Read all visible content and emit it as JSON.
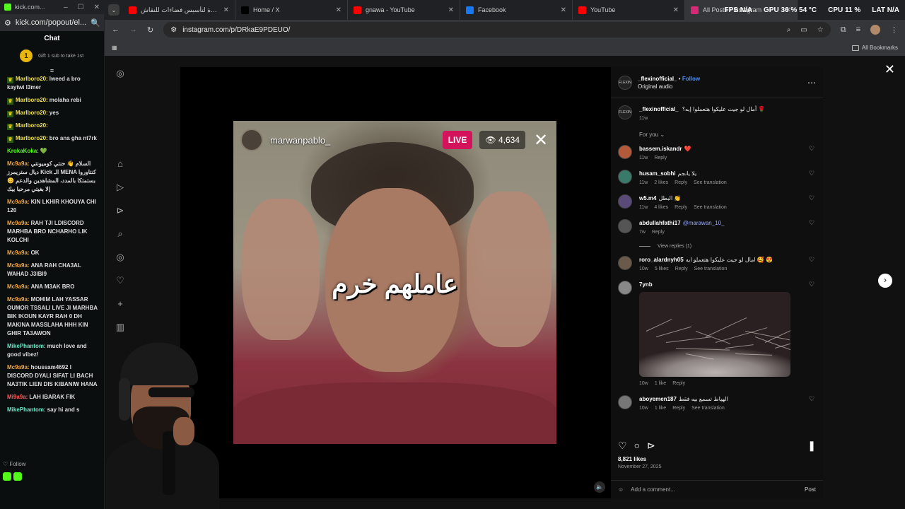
{
  "chat_window": {
    "title": "kick.com...",
    "url": "kick.com/popout/el...",
    "header": "Chat",
    "gift_count": "1",
    "gift_text": "Gift 1 sub to take 1st",
    "messages": [
      {
        "user": "Marlboro20:",
        "text": "lweed a bro kaytwi l3mer",
        "color": "#f2e34b",
        "badge": true
      },
      {
        "user": "Marlboro20:",
        "text": "molaha rebi",
        "color": "#f2e34b",
        "badge": true
      },
      {
        "user": "Marlboro20:",
        "text": "yes",
        "color": "#f2e34b",
        "badge": true
      },
      {
        "user": "Marlboro20:",
        "text": "",
        "color": "#f2e34b",
        "badge": true
      },
      {
        "user": "Marlboro20:",
        "text": "bro ana gha nt7rk",
        "color": "#f2e34b",
        "badge": true
      },
      {
        "user": "KrokaKoka:",
        "text": "💚",
        "color": "#53fc18",
        "badge": false
      },
      {
        "user": "Mc9a9a:",
        "text": "السلام 👋 حنتي كوميونتي ديال ستريمرز Kick الـ MENA كنتاوروا بستمتكا بالمدد، المشاهدين والدعم 😊 إلا بغيتي مرحبا بيك",
        "color": "#f4a742",
        "badge": false
      },
      {
        "user": "Mc9a9a:",
        "text": "KIN LKHIR KHOUYA CHI 120",
        "color": "#f4a742",
        "badge": false
      },
      {
        "user": "Mc9a9a:",
        "text": "RAH TJI LDISCORD MARHBA BRO NCHARHO LIK KOLCHI",
        "color": "#f4a742",
        "badge": false
      },
      {
        "user": "Mc9a9a:",
        "text": "OK",
        "color": "#f4a742",
        "badge": false
      },
      {
        "user": "Mc9a9a:",
        "text": "ANA RAH CHA3AL WAHAD J3IBI9",
        "color": "#f4a742",
        "badge": false
      },
      {
        "user": "Mc9a9a:",
        "text": "ANA M3AK BRO",
        "color": "#f4a742",
        "badge": false
      },
      {
        "user": "Mc9a9a:",
        "text": "MOHIM LAH YASSAR OUMOR TSSALI LIVE JI MARHBA BIK IKOUN KAYR RAH 0 DH MAKINA MASSLAHA HHH KIN GHIR TA3AWON",
        "color": "#f4a742",
        "badge": false
      },
      {
        "user": "MikePhantom:",
        "text": "much love and good vibez!",
        "color": "#6ee7c8",
        "badge": false
      },
      {
        "user": "Mc9a9a:",
        "text": "houssam4692 I DISCORD DYALI SIFAT LI BACH NA3TIK LIEN DIS KIBANIW HANA",
        "color": "#f4a742",
        "badge": false
      },
      {
        "user": "Mi9a9a:",
        "text": "LAH IBARAK FIK",
        "color": "#ff5b5b",
        "badge": false
      },
      {
        "user": "MikePhantom:",
        "text": "say hi and s",
        "color": "#6ee7c8",
        "badge": false
      }
    ],
    "follow_label": "Follow"
  },
  "tabs": [
    {
      "title": "دعوة لتأسيس فضاءات للنقاش",
      "icon": "youtube-icon",
      "color": "#ff0000",
      "active": false
    },
    {
      "title": "Home / X",
      "icon": "x-icon",
      "color": "#000000",
      "active": false
    },
    {
      "title": "gnawa - YouTube",
      "icon": "youtube-icon",
      "color": "#ff0000",
      "active": false
    },
    {
      "title": "Facebook",
      "icon": "facebook-icon",
      "color": "#1877f2",
      "active": false
    },
    {
      "title": "YouTube",
      "icon": "youtube-icon",
      "color": "#ff0000",
      "active": false
    },
    {
      "title": "All Posts • Instagram",
      "icon": "instagram-icon",
      "color": "#d62976",
      "active": true
    }
  ],
  "overlay": {
    "fps": "FPS N/A",
    "gpu": "GPU 36 % 54 °C",
    "cpu": "CPU 11 %",
    "lat": "LAT N/A"
  },
  "address_bar": {
    "url": "instagram.com/p/DRkaE9PDEUO/"
  },
  "bookmarks": {
    "all_label": "All Bookmarks"
  },
  "video": {
    "username": "marwanpablo_",
    "live_label": "LIVE",
    "viewers": "4,634",
    "caption": "عاملهم خرم"
  },
  "post": {
    "author": "_flexinofficial_",
    "follow_label": "Follow",
    "audio": "Original audio",
    "author_caption": "أمال لو جيت عليكوا هتعملوا إيه؟ 🌹",
    "author_time": "11w",
    "for_you": "For you",
    "comments": [
      {
        "user": "bassem.iskandr",
        "text": "❤️",
        "time": "11w",
        "likes": "",
        "translate": false,
        "avatar": "#b35a3a"
      },
      {
        "user": "husam_sobhi",
        "text": "يلا يانجم",
        "time": "11w",
        "likes": "2 likes",
        "translate": true,
        "avatar": "#3a7a6a"
      },
      {
        "user": "w5.m4",
        "text": "البطل 👏",
        "time": "11w",
        "likes": "4 likes",
        "translate": true,
        "avatar": "#5a4a7a"
      },
      {
        "user": "abdullahfathi17",
        "text": "@marawan_10_",
        "time": "7w",
        "likes": "",
        "translate": false,
        "avatar": "#555555",
        "mention": true
      }
    ],
    "view_replies": "View replies (1)",
    "comments2": [
      {
        "user": "roro_alardnyh05",
        "text": "امال لو جيت عليكوا هتعملو ايه 🥰 😍",
        "time": "10w",
        "likes": "5 likes",
        "translate": true,
        "avatar": "#6a5a4a"
      },
      {
        "user": "7ynb",
        "text": "",
        "time": "10w",
        "likes": "1 like",
        "translate": false,
        "avatar": "#888888",
        "image": true
      },
      {
        "user": "aboyemen187",
        "text": "الهياط تسمع بيه فقط",
        "time": "10w",
        "likes": "1 like",
        "translate": true,
        "avatar": "#777777"
      }
    ],
    "reply_label": "Reply",
    "translate_label": "See translation",
    "likes_count": "8,821 likes",
    "date": "November 27, 2025",
    "add_comment": "Add a comment...",
    "post_label": "Post"
  }
}
